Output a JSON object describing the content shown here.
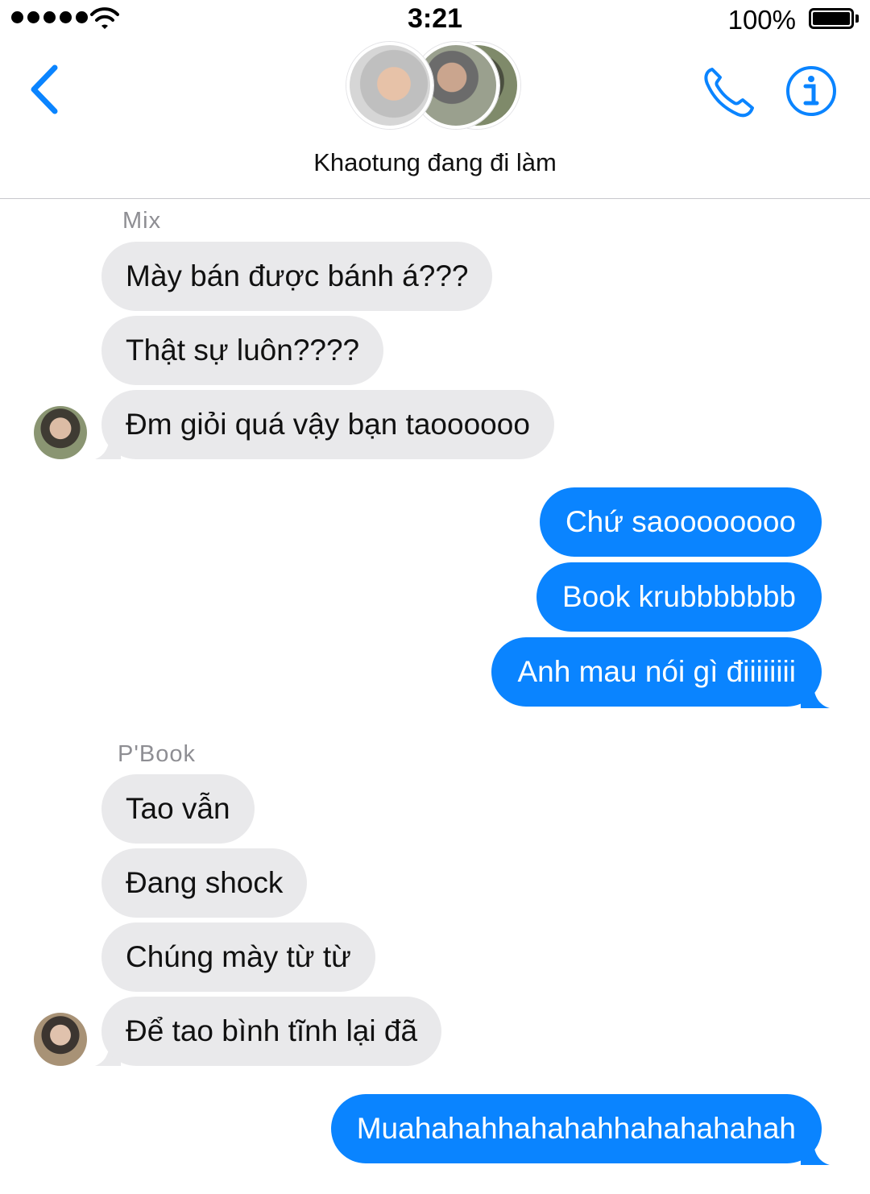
{
  "status_bar": {
    "time": "3:21",
    "battery": "100%"
  },
  "header": {
    "title": "Khaotung đang đi làm"
  },
  "colors": {
    "accent": "#0a84ff",
    "incoming_bubble": "#e9e9eb",
    "sender_label": "#8e8e93"
  },
  "icons": {
    "back": "chevron-left-icon",
    "call": "phone-icon",
    "info": "info-icon"
  },
  "messages": {
    "group1": {
      "sender": "Mix",
      "items": [
        "Mày bán được bánh á???",
        "Thật sự luôn????",
        "Đm giỏi quá vậy bạn taoooooo"
      ]
    },
    "outgoing1": [
      "Chứ saoooooooo",
      "Book krubbbbbbb",
      "Anh mau nói gì điiiiiiii"
    ],
    "group2": {
      "sender": "P'Book",
      "items": [
        "Tao vẫn",
        "Đang shock",
        "Chúng mày từ từ",
        "Để tao bình tĩnh lại đã"
      ]
    },
    "outgoing2": [
      "Muahahahhahahahhahahahahah"
    ]
  }
}
